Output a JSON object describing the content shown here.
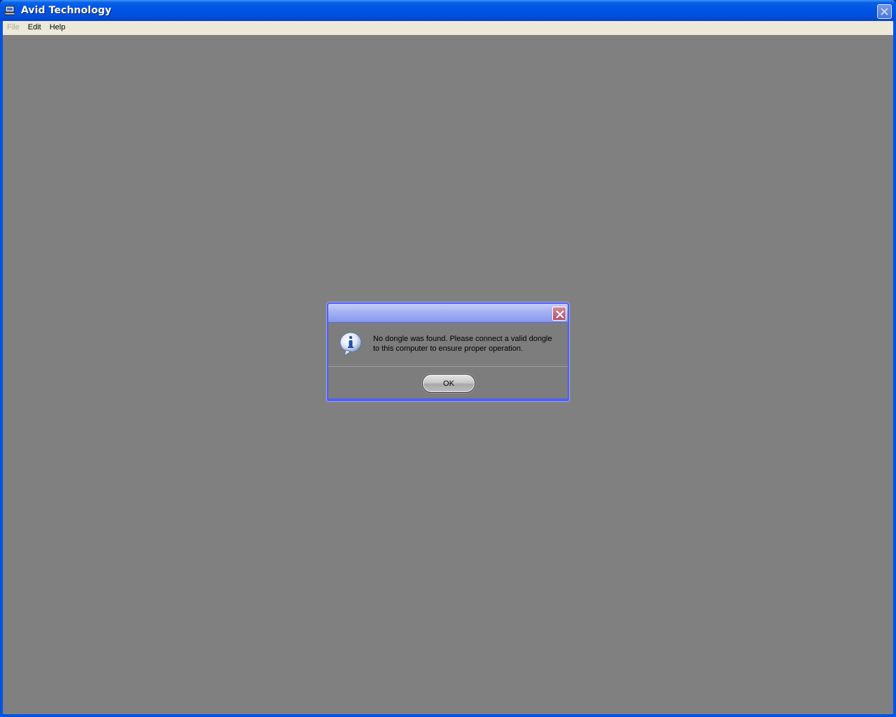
{
  "window": {
    "title": "Avid Technology",
    "icon": "computer-icon",
    "close_icon": "close-icon"
  },
  "menubar": {
    "items": [
      {
        "label": "File",
        "enabled": false
      },
      {
        "label": "Edit",
        "enabled": true
      },
      {
        "label": "Help",
        "enabled": true
      }
    ]
  },
  "dialog": {
    "title": "",
    "icon": "info-icon",
    "message_line1": "No dongle was found. Please connect a valid dongle",
    "message_line2": "to this computer to ensure proper operation.",
    "ok_label": "OK"
  },
  "colors": {
    "titlebar": "#0055e5",
    "client_background": "#808080",
    "dialog_border": "#4f5ff0",
    "menubar": "#ece9d8"
  }
}
